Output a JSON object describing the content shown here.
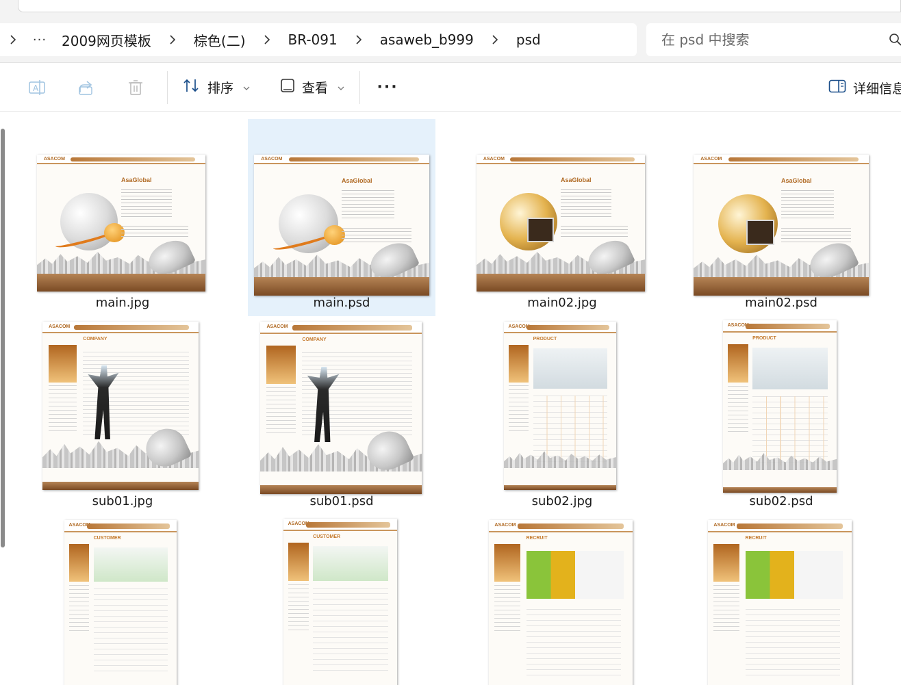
{
  "breadcrumb": {
    "items": [
      "2009网页模板",
      "棕色(二)",
      "BR-091",
      "asaweb_b999",
      "psd"
    ]
  },
  "search": {
    "placeholder": "在 psd 中搜索"
  },
  "toolbar": {
    "sort_label": "排序",
    "view_label": "查看",
    "details_label": "详细信息"
  },
  "files": [
    {
      "name": "main.jpg",
      "thumb": "main-globe"
    },
    {
      "name": "main.psd",
      "thumb": "main-globe",
      "selected": true
    },
    {
      "name": "main02.jpg",
      "thumb": "main-business"
    },
    {
      "name": "main02.psd",
      "thumb": "main-business"
    },
    {
      "name": "sub01.jpg",
      "thumb": "company"
    },
    {
      "name": "sub01.psd",
      "thumb": "company"
    },
    {
      "name": "sub02.jpg",
      "thumb": "product"
    },
    {
      "name": "sub02.psd",
      "thumb": "product"
    },
    {
      "name": "",
      "thumb": "customer"
    },
    {
      "name": "",
      "thumb": "customer"
    },
    {
      "name": "",
      "thumb": "recruit"
    },
    {
      "name": "",
      "thumb": "recruit"
    }
  ],
  "thumb_text": {
    "logo": "ASACOM",
    "asaglobal": "AsaGlobal",
    "company": "COMPANY",
    "product": "PRODUCT",
    "customer": "CUSTOMER",
    "recruit": "RECRUIT"
  },
  "colors": {
    "selected_bg": "#e5f1fb",
    "accent_brown": "#b06a24"
  }
}
